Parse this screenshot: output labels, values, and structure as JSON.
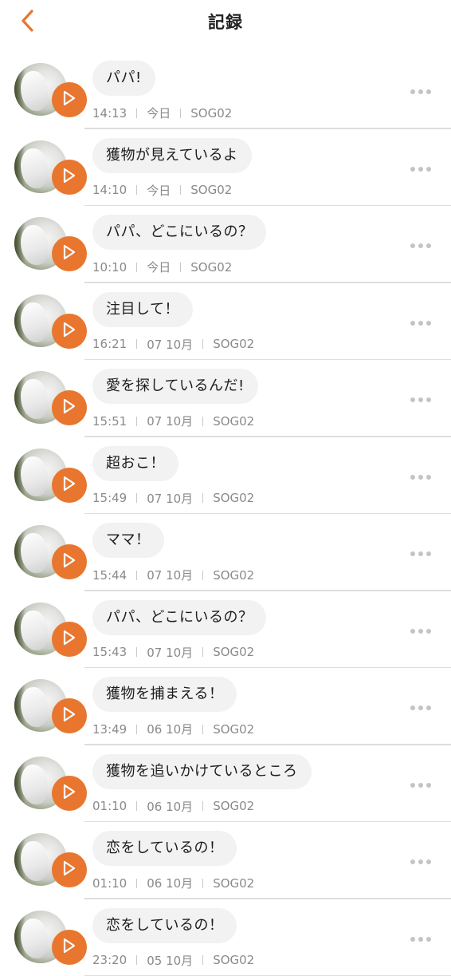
{
  "header": {
    "title": "記録"
  },
  "icons": {
    "back": "chevron-left-icon",
    "play": "play-icon",
    "more": "more-horizontal-icon"
  },
  "colors": {
    "accent": "#e8762e",
    "bubble": "#f2f2f2",
    "meta_text": "#8a8a8a",
    "divider": "#dedede"
  },
  "records": [
    {
      "message": "パパ!",
      "time": "14:13",
      "date": "今日",
      "device": "SOG02"
    },
    {
      "message": "獲物が見えているよ",
      "time": "14:10",
      "date": "今日",
      "device": "SOG02"
    },
    {
      "message": "パパ、どこにいるの？",
      "time": "10:10",
      "date": "今日",
      "device": "SOG02"
    },
    {
      "message": "注目して！",
      "time": "16:21",
      "date": "07 10月",
      "device": "SOG02"
    },
    {
      "message": "愛を探しているんだ!",
      "time": "15:51",
      "date": "07 10月",
      "device": "SOG02"
    },
    {
      "message": "超おこ！",
      "time": "15:49",
      "date": "07 10月",
      "device": "SOG02"
    },
    {
      "message": "ママ！",
      "time": "15:44",
      "date": "07 10月",
      "device": "SOG02"
    },
    {
      "message": "パパ、どこにいるの？",
      "time": "15:43",
      "date": "07 10月",
      "device": "SOG02"
    },
    {
      "message": "獲物を捕まえる！",
      "time": "13:49",
      "date": "06 10月",
      "device": "SOG02"
    },
    {
      "message": "獲物を追いかけているところ",
      "time": "01:10",
      "date": "06 10月",
      "device": "SOG02"
    },
    {
      "message": "恋をしているの！",
      "time": "01:10",
      "date": "06 10月",
      "device": "SOG02"
    },
    {
      "message": "恋をしているの！",
      "time": "23:20",
      "date": "05 10月",
      "device": "SOG02"
    }
  ]
}
